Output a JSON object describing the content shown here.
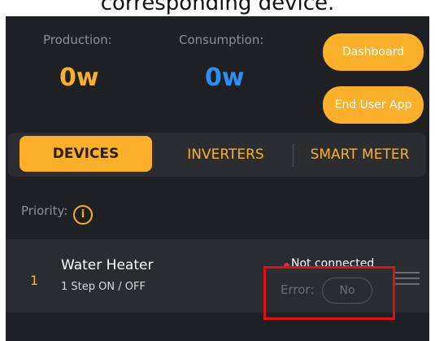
{
  "caption": "corresponding device.",
  "summary": {
    "production_label": "Production:",
    "production_value": "0w",
    "consumption_label": "Consumption:",
    "consumption_value": "0w"
  },
  "buttons": {
    "dashboard": "Dashboard",
    "end_user_app": "End User App"
  },
  "tabs": [
    {
      "label": "DEVICES",
      "active": true
    },
    {
      "label": "INVERTERS",
      "active": false
    },
    {
      "label": "SMART METER",
      "active": false
    }
  ],
  "priority_label": "Priority:",
  "device": {
    "number": "1",
    "name": "Water Heater",
    "type": "1 Step ON / OFF",
    "status": "Not connected",
    "error_label": "Error:",
    "error_value": "No"
  },
  "colors": {
    "accent": "#fbb02b",
    "production_value": "#fbb02b",
    "consumption_value": "#2f8ff0",
    "status_dot": "#e0304a",
    "highlight_box": "#e0101a"
  },
  "icons": {
    "info": "info-circle-icon",
    "drag": "drag-handle-icon"
  }
}
